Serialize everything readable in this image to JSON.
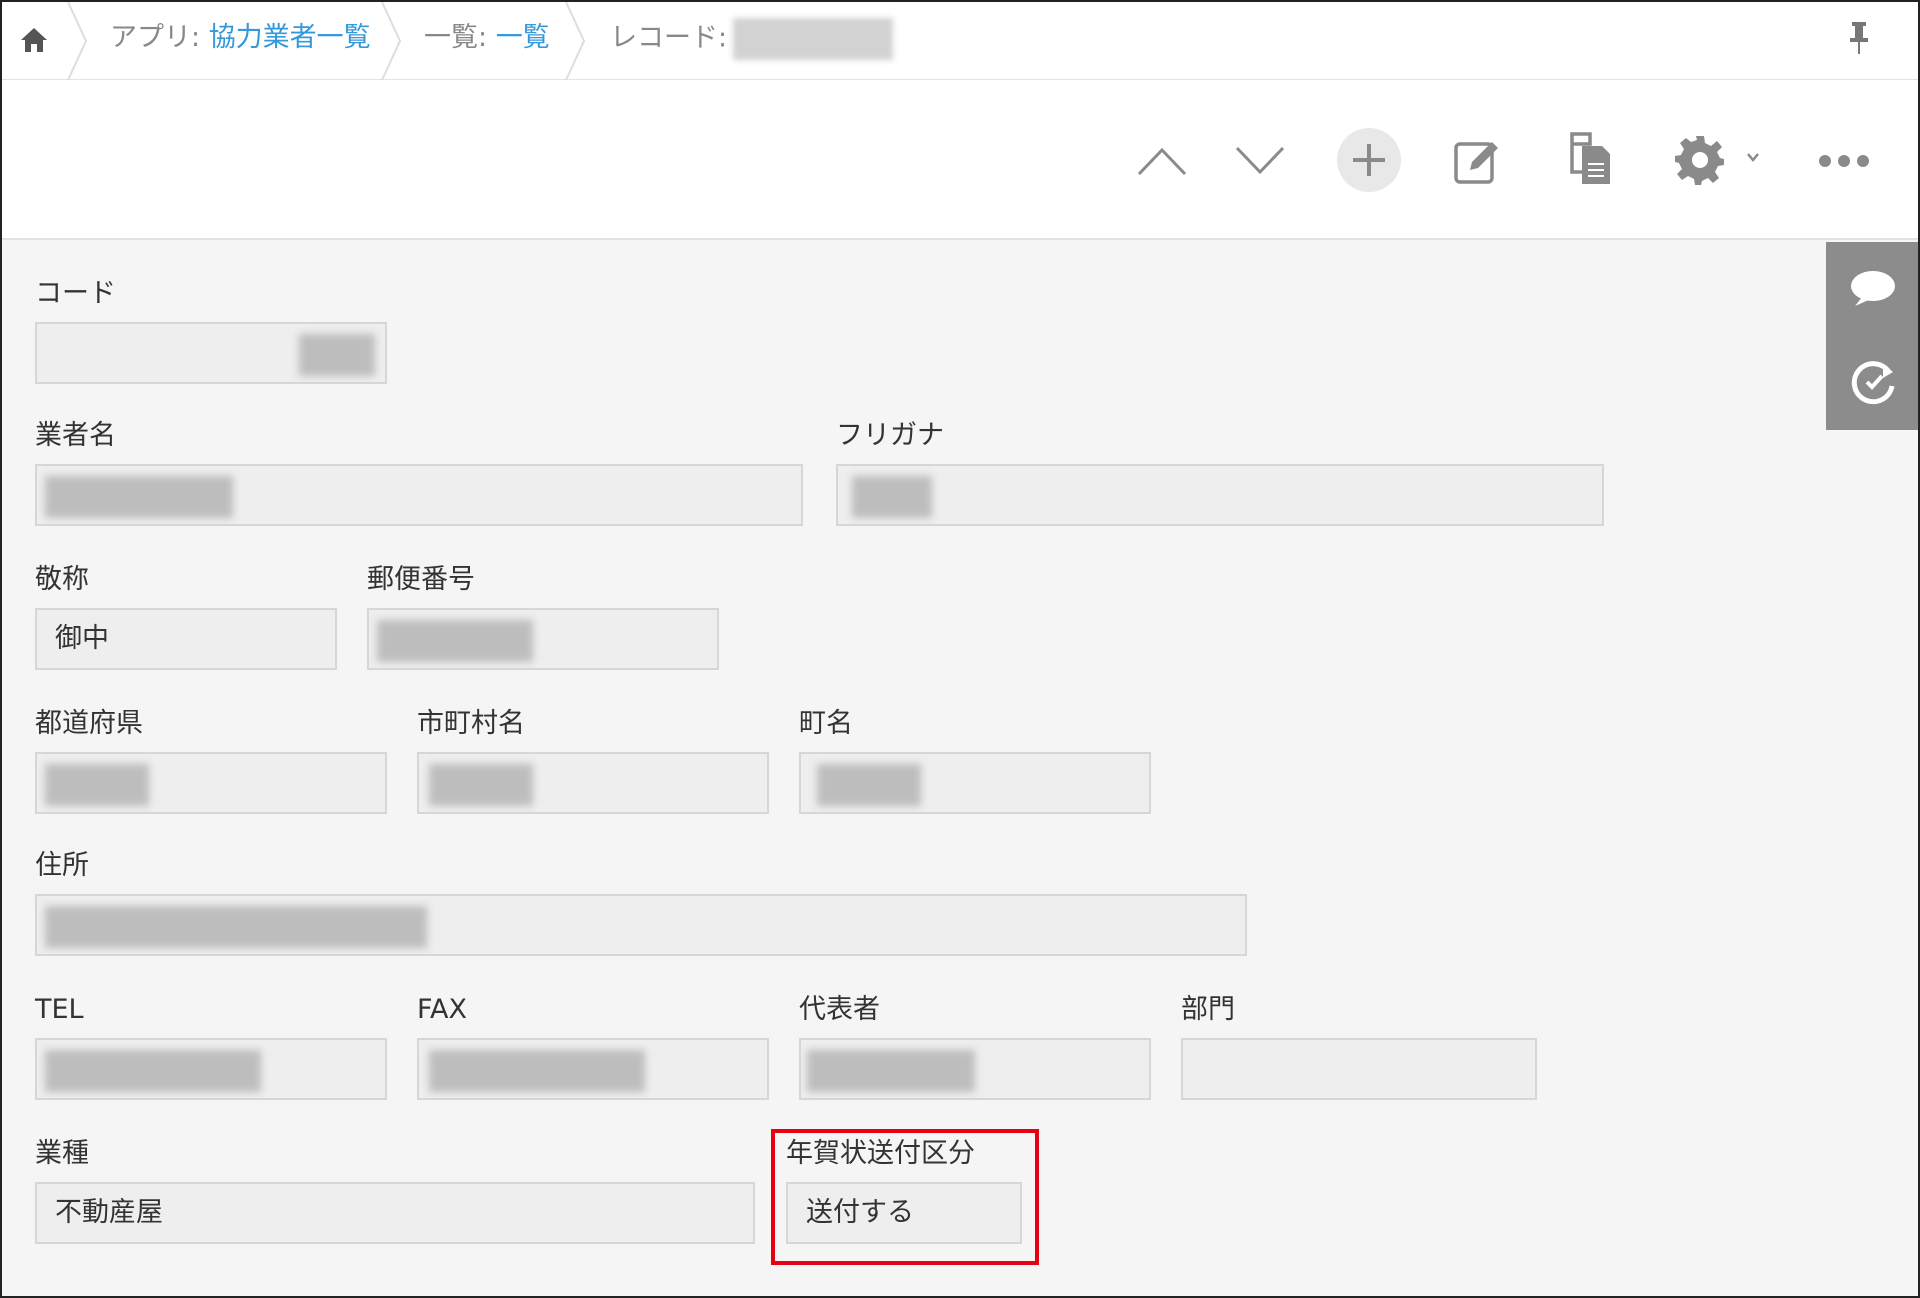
{
  "breadcrumb": {
    "app_prefix": "アプリ: ",
    "app_name": "協力業者一覧",
    "view_prefix": "一覧: ",
    "view_name": "一覧",
    "record_prefix": "レコード:"
  },
  "icons": {
    "home": "home-icon",
    "pin": "pin-icon",
    "prev": "chevron-up-icon",
    "next": "chevron-down-icon",
    "add": "plus-icon",
    "edit": "edit-icon",
    "duplicate": "duplicate-icon",
    "settings": "gear-icon",
    "more": "more-icon",
    "comment": "comment-icon",
    "history": "history-icon"
  },
  "colors": {
    "link": "#3498db",
    "highlight": "#e60012",
    "side_panel": "#8c8c8c"
  },
  "fields": {
    "code": {
      "label": "コード",
      "value": ""
    },
    "company_name": {
      "label": "業者名",
      "value": ""
    },
    "furigana": {
      "label": "フリガナ",
      "value": ""
    },
    "honorific": {
      "label": "敬称",
      "value": "御中"
    },
    "postal_code": {
      "label": "郵便番号",
      "value": ""
    },
    "prefecture": {
      "label": "都道府県",
      "value": ""
    },
    "city": {
      "label": "市町村名",
      "value": ""
    },
    "town": {
      "label": "町名",
      "value": ""
    },
    "address": {
      "label": "住所",
      "value": ""
    },
    "tel": {
      "label": "TEL",
      "value": ""
    },
    "fax": {
      "label": "FAX",
      "value": ""
    },
    "representative": {
      "label": "代表者",
      "value": ""
    },
    "department": {
      "label": "部門",
      "value": ""
    },
    "industry": {
      "label": "業種",
      "value": "不動産屋"
    },
    "new_year_card": {
      "label": "年賀状送付区分",
      "value": "送付する"
    }
  }
}
